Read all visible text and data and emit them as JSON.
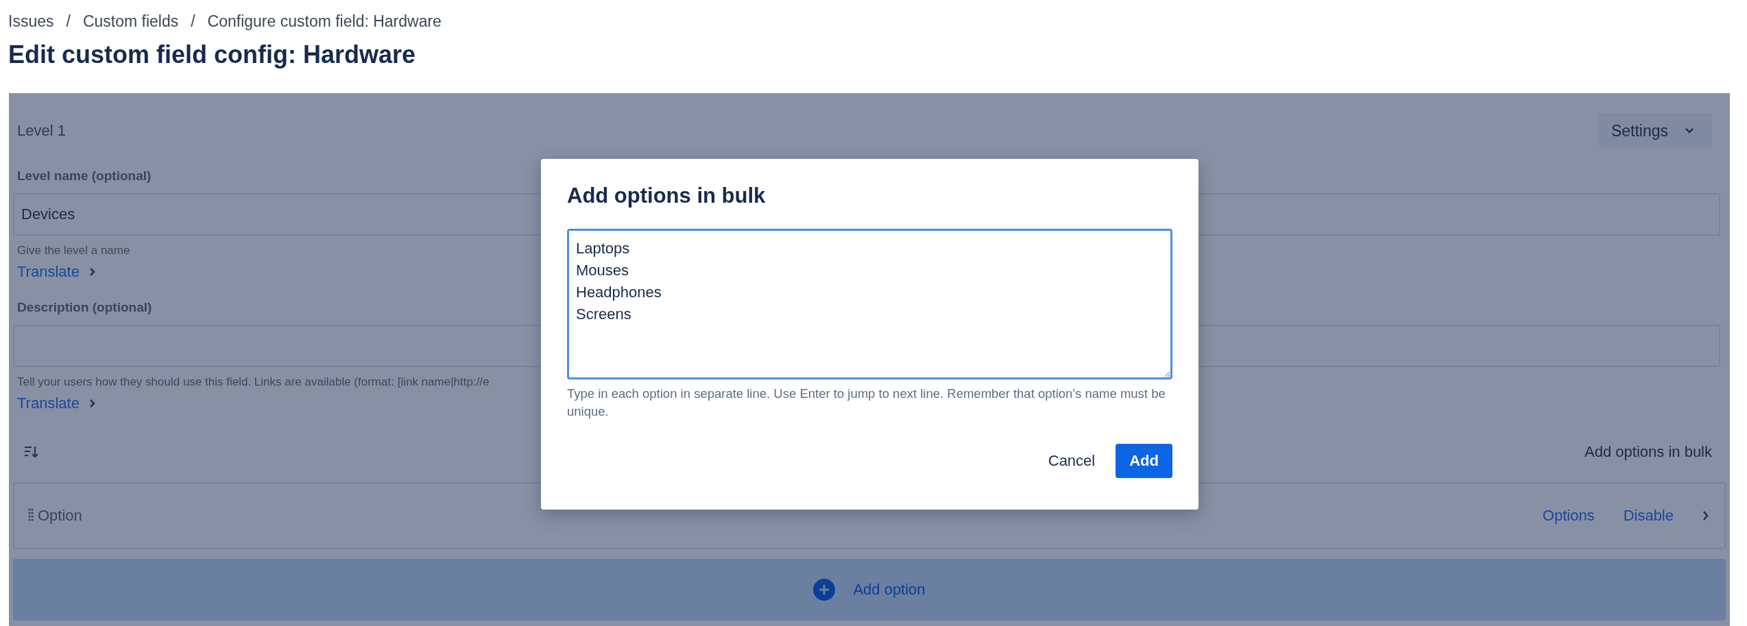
{
  "breadcrumbs": {
    "separator": "/",
    "items": [
      "Issues",
      "Custom fields",
      "Configure custom field: Hardware"
    ]
  },
  "page_title": "Edit custom field config: Hardware",
  "level": {
    "heading": "Level 1",
    "settings_button": "Settings",
    "fields": [
      {
        "label": "Level name (optional)",
        "value": "Devices",
        "helper": "Give the level a name",
        "translate_link": "Translate"
      },
      {
        "label": "Description (optional)",
        "helper": "Tell your users how they should use this field. Links are available (format: [link name|http://e",
        "translate_link": "Translate"
      }
    ],
    "bulk_link": "Add options in bulk",
    "options": [
      {
        "label": "Option",
        "actions": [
          "Options",
          "Disable"
        ]
      }
    ],
    "add_option_button": "Add option"
  },
  "dialog": {
    "title": "Add options in bulk",
    "value": "Laptops\nMouses\nHeadphones\nScreens",
    "helper": "Type in each option in separate line. Use Enter to jump to next line. Remember that option’s name must be unique.",
    "buttons": [
      {
        "label": "Cancel",
        "kind": "subtle"
      },
      {
        "label": "Add",
        "kind": "primary"
      }
    ]
  }
}
